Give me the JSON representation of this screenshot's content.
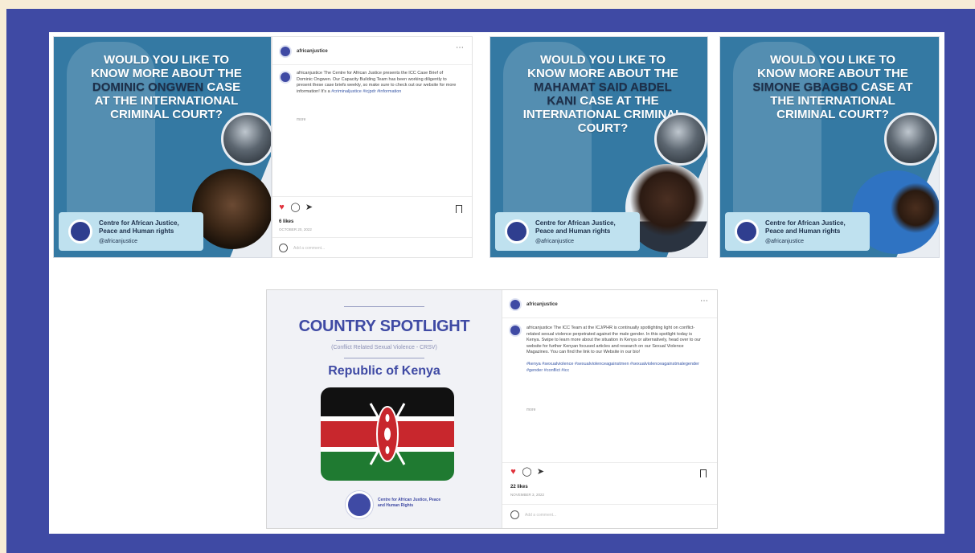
{
  "colors": {
    "frame": "#3f4aa4",
    "page_bg": "#f7ecd6",
    "promo_blue": "#3479a3",
    "kenya_black": "#111111",
    "kenya_red": "#c8272d",
    "kenya_green": "#1f7a31"
  },
  "posts": [
    {
      "headline_pre": "Would you like to know more about the",
      "headline_name": "Dominic Ongwen",
      "headline_post": "case at the International Criminal Court?",
      "org_name": "Centre for African Justice, Peace and Human rights",
      "org_handle": "@africanjustice"
    },
    {
      "headline_pre": "Would you like to know more about the",
      "headline_name": "Mahamat Said Abdel Kani",
      "headline_post": "case at the International Criminal Court?",
      "org_name": "Centre for African Justice, Peace and Human rights",
      "org_handle": "@africanjustice"
    },
    {
      "headline_pre": "Would you like to know more about the",
      "headline_name": "Simone Gbagbo",
      "headline_post": "case at the International Criminal Court?",
      "org_name": "Centre for African Justice, Peace and Human rights",
      "org_handle": "@africanjustice"
    }
  ],
  "ig_post_1": {
    "username": "africanjustice",
    "caption": "africanjustice The Centre for African Justice presents the ICC Case Brief of Dominic Ongwen. Our Capacity Building Team has been working diligently to present these case briefs weekly, so make sure to check out our website for more information! It's a",
    "tags": "#criminaljustice #icjpdr #information",
    "see_more": "more",
    "likes": "6 likes",
    "date": "OCTOBER 20, 2022",
    "comment_placeholder": "Add a comment..."
  },
  "spotlight": {
    "title": "COUNTRY SPOTLIGHT",
    "subtitle": "(Conflict Related Sexual Violence - CRSV)",
    "country": "Republic of Kenya",
    "org_name": "Centre for African Justice, Peace and Human Rights"
  },
  "ig_post_2": {
    "username": "africanjustice",
    "caption": "africanjustice The ICC Team at the ICJ/PHR is continually spotlighting light on conflict-related sexual violence perpetrated against the male gender. In this spotlight today is Kenya. Swipe to learn more about the situation in Kenya or alternatively, head over to our website for further Kenyan focused articles and research on our Sexual Violence Magazines. You can find the link to our Website in our bio!",
    "tags": "#kenya #sexualviolence #sexualviolenceagainstmen #sexualviolenceagainstmalegender #gender #conflict #icc",
    "see_more": "more",
    "likes": "22 likes",
    "date": "NOVEMBER 3, 2022",
    "comment_placeholder": "Add a comment..."
  }
}
